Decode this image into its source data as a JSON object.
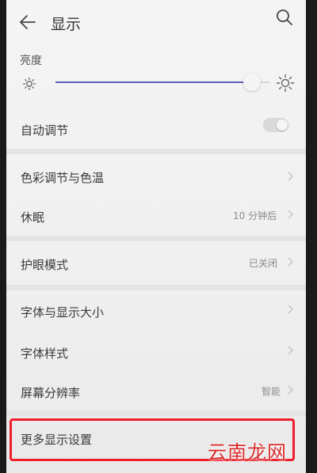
{
  "header": {
    "title": "显示",
    "back_icon": "arrow-left-icon",
    "search_icon": "search-icon"
  },
  "brightness": {
    "label": "亮度",
    "level": 0.9,
    "low_icon": "sun-small-icon",
    "high_icon": "sun-large-icon"
  },
  "settings": {
    "auto_adjust": {
      "label": "自动调节",
      "enabled": false
    },
    "color_temp": {
      "label": "色彩调节与色温"
    },
    "sleep": {
      "label": "休眠",
      "value": "10 分钟后"
    },
    "eye_protect": {
      "label": "护眼模式",
      "value": "已关闭"
    },
    "font_size": {
      "label": "字体与显示大小"
    },
    "font_style": {
      "label": "字体样式"
    },
    "resolution": {
      "label": "屏幕分辨率",
      "value": "智能"
    },
    "more": {
      "label": "更多显示设置"
    }
  },
  "watermark": "云南龙网",
  "colors": {
    "accent": "#5b5fb3",
    "highlight_border": "#ee1e2b",
    "watermark": "#d92c2c"
  }
}
